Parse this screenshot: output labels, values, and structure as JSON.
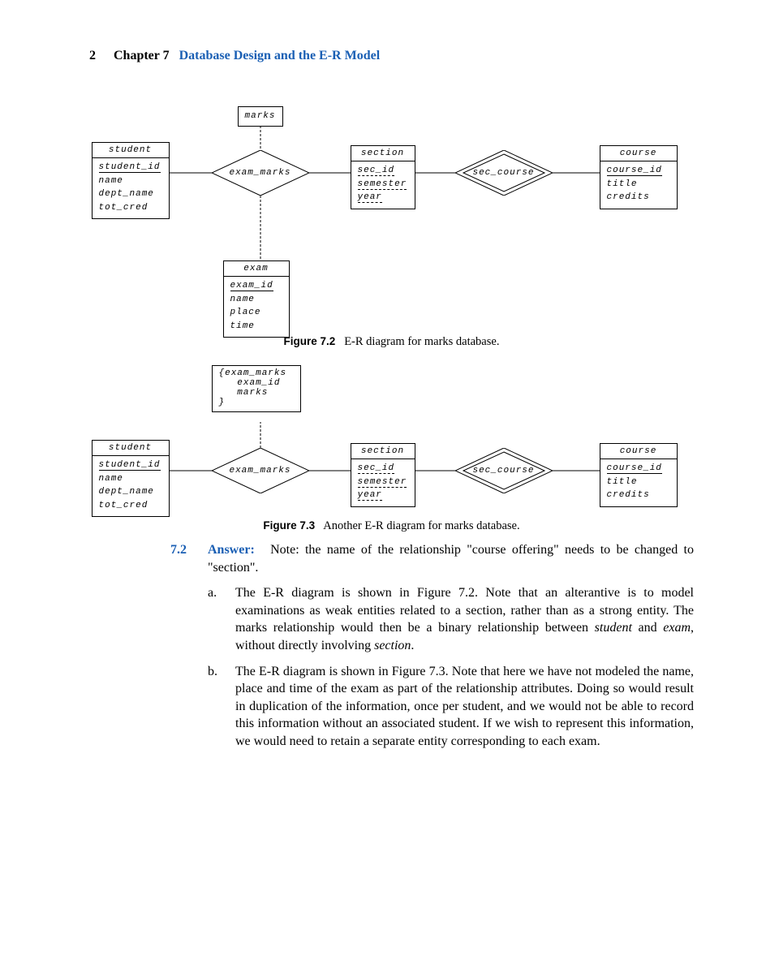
{
  "header": {
    "page_number": "2",
    "chapter": "Chapter 7",
    "title": "Database Design and the E-R Model"
  },
  "entities": {
    "student": {
      "title": "student",
      "attrs": [
        "student_id",
        "name",
        "dept_name",
        "tot_cred"
      ],
      "pk_index": 0
    },
    "section": {
      "title": "section",
      "attrs": [
        "sec_id",
        "semester",
        "year"
      ]
    },
    "course": {
      "title": "course",
      "attrs": [
        "course_id",
        "title",
        "credits"
      ],
      "pk_index": 0
    },
    "exam": {
      "title": "exam",
      "attrs": [
        "exam_id",
        "name",
        "place",
        "time"
      ],
      "pk_index": 0
    },
    "marks_attr": {
      "title": "marks",
      "body": "{exam_marks\n   exam_id\n   marks\n}"
    }
  },
  "relationships": {
    "exam_marks": "exam_marks",
    "sec_course": "sec_course"
  },
  "captions": {
    "fig72_num": "Figure 7.2",
    "fig72_text": "E-R diagram for marks database.",
    "fig73_num": "Figure 7.3",
    "fig73_text": "Another E-R diagram for marks database."
  },
  "answer": {
    "num": "7.2",
    "label": "Answer:",
    "lead": "Note: the name of the relationship \"course offering\" needs to be changed to \"section\".",
    "a_letter": "a.",
    "a_text_pre": "The ",
    "a_text_er": "E-R",
    "a_text_mid": " diagram is shown in Figure 7.2. Note that an alterantive is to model examinations as weak entities related to a section, rather than as a strong entity. The marks relationship would then be a binary relationship between ",
    "a_text_i1": "student",
    "a_text_and": " and ",
    "a_text_i2": "exam",
    "a_text_tail": ", without directly involving ",
    "a_text_i3": "section",
    "a_text_end": ".",
    "b_letter": "b.",
    "b_text_pre": "The ",
    "b_text_er": "E-R",
    "b_text": " diagram is shown in Figure 7.3. Note that here we have not modeled the name, place and time of the exam as part of the relationship attributes. Doing so would result in duplication of the information, once per student, and we would not be able to record this information without an associated student. If we wish to represent this information, we would need to retain a separate entity corresponding to each exam."
  }
}
